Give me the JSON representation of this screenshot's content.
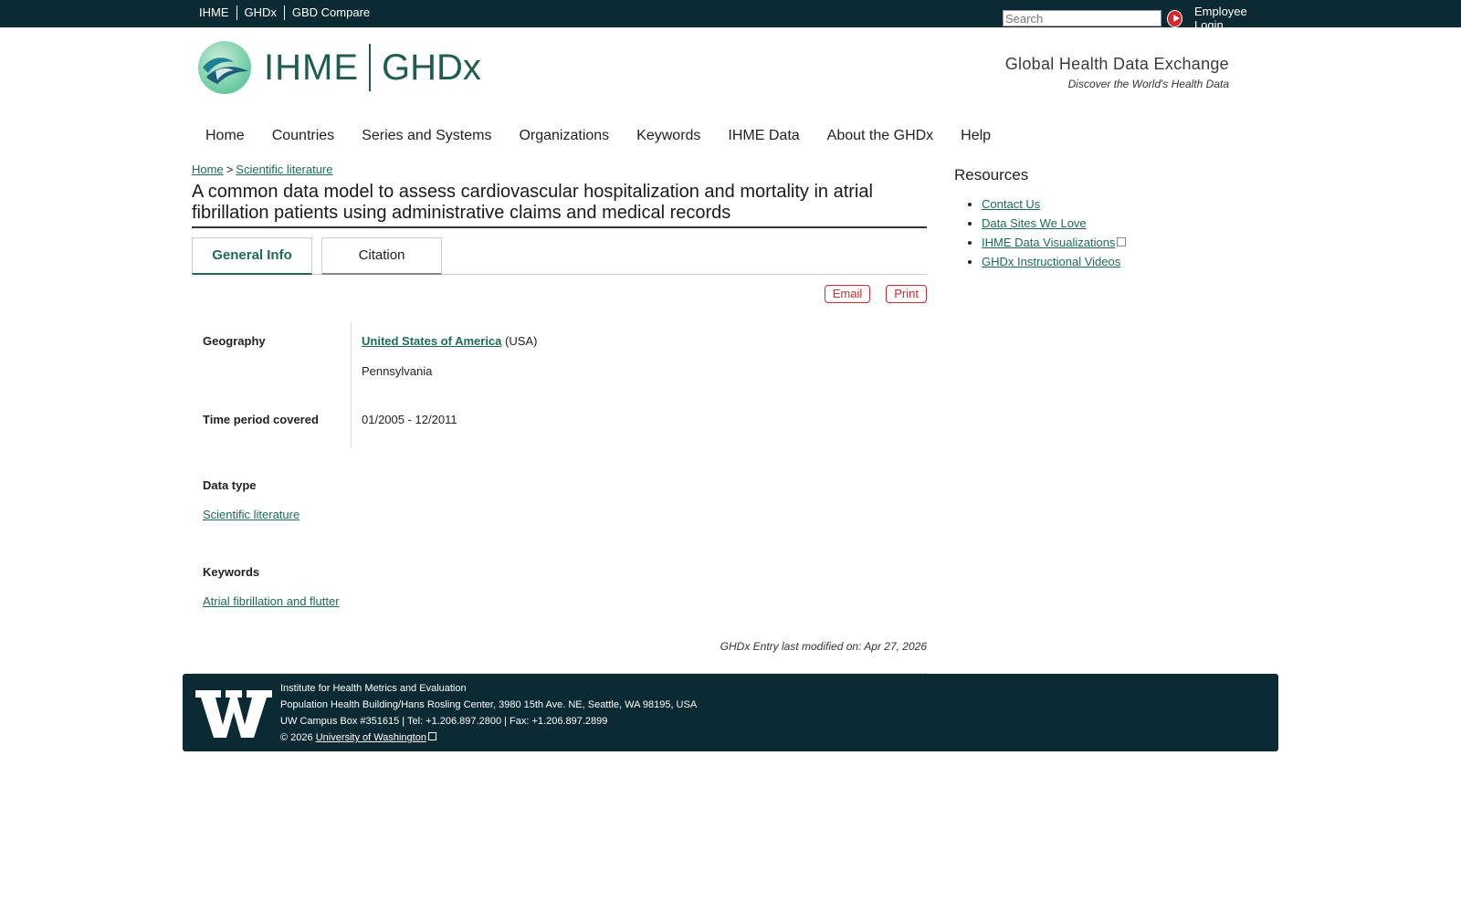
{
  "topbar": {
    "links": [
      "IHME",
      "GHDx",
      "GBD Compare"
    ],
    "search_placeholder": "Search",
    "login": "Employee Login"
  },
  "header": {
    "ihme": "IHME",
    "ghdx": "GHDx",
    "tagline_title": "Global Health Data Exchange",
    "tagline_sub": "Discover the World's Health Data"
  },
  "nav": [
    "Home",
    "Countries",
    "Series and Systems",
    "Organizations",
    "Keywords",
    "IHME Data",
    "About the GHDx",
    "Help"
  ],
  "breadcrumb": {
    "home": "Home",
    "sep": ">",
    "current": "Scientific literature"
  },
  "title": "A common data model to assess cardiovascular hospitalization and mortality in atrial fibrillation patients using administrative claims and medical records",
  "tabs": {
    "general": "General Info",
    "citation": "Citation"
  },
  "actions": {
    "email": "Email",
    "print": "Print"
  },
  "fields": {
    "geography_label": "Geography",
    "country": "United States of America",
    "country_code": "(USA)",
    "state": "Pennsylvania",
    "time_label": "Time period covered",
    "time_value": "01/2005 - 12/2011"
  },
  "data_type": {
    "label": "Data type",
    "value": "Scientific literature"
  },
  "keywords": {
    "label": "Keywords",
    "value": "Atrial fibrillation and flutter"
  },
  "modified": "GHDx Entry last modified on: Apr 27, 2026",
  "resources": {
    "title": "Resources",
    "items": [
      "Contact Us",
      "Data Sites We Love",
      "IHME Data Visualizations",
      "GHDx Instructional Videos"
    ]
  },
  "footer": {
    "line1": "Institute for Health Metrics and Evaluation",
    "line2": "Population Health Building/Hans Rosling Center, 3980 15th Ave. NE, Seattle, WA 98195, USA",
    "line3": "UW Campus Box #351615 | Tel: +1.206.897.2800 | Fax: +1.206.897.2899",
    "copyright": "© 2026",
    "uw_link": "University of Washington"
  },
  "colors": {
    "dark": "#0c2a33",
    "link": "#1e6b52",
    "red": "#d0282f"
  }
}
